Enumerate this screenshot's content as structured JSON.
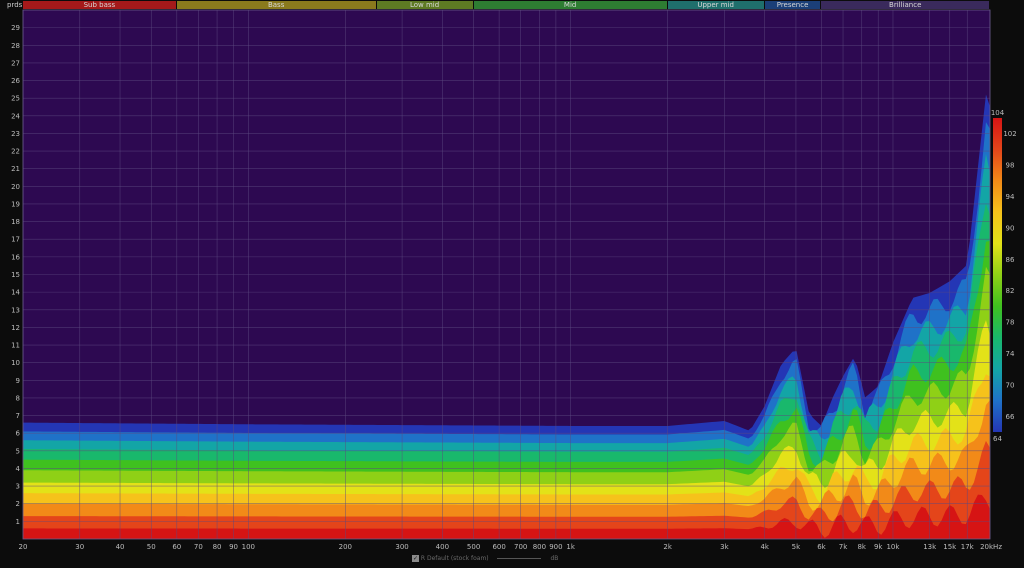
{
  "header": {
    "periods_label": "prds"
  },
  "bands": [
    {
      "name": "Sub bass",
      "from_hz": 20,
      "to_hz": 60,
      "color": "#a5191a"
    },
    {
      "name": "Bass",
      "from_hz": 60,
      "to_hz": 250,
      "color": "#8a7a1d"
    },
    {
      "name": "Low mid",
      "from_hz": 250,
      "to_hz": 500,
      "color": "#5e7a23"
    },
    {
      "name": "Mid",
      "from_hz": 500,
      "to_hz": 2000,
      "color": "#2e7d32"
    },
    {
      "name": "Upper mid",
      "from_hz": 2000,
      "to_hz": 4000,
      "color": "#1f6f6c"
    },
    {
      "name": "Presence",
      "from_hz": 4000,
      "to_hz": 6000,
      "color": "#1b3f78"
    },
    {
      "name": "Brilliance",
      "from_hz": 6000,
      "to_hz": 20000,
      "color": "#3a2a5c"
    }
  ],
  "legend": {
    "checked": true,
    "label": "R Default (stock foam)",
    "unit": "dB"
  },
  "chart_data": {
    "type": "heatmap",
    "title": "",
    "x_scale": "log",
    "xlim_hz": [
      20,
      20000
    ],
    "ylim_periods": [
      0,
      30
    ],
    "x_ticks": [
      {
        "v": 20,
        "label": "20"
      },
      {
        "v": 30,
        "label": "30"
      },
      {
        "v": 40,
        "label": "40"
      },
      {
        "v": 50,
        "label": "50"
      },
      {
        "v": 60,
        "label": "60"
      },
      {
        "v": 70,
        "label": "70"
      },
      {
        "v": 80,
        "label": "80"
      },
      {
        "v": 90,
        "label": "90"
      },
      {
        "v": 100,
        "label": "100"
      },
      {
        "v": 200,
        "label": "200"
      },
      {
        "v": 300,
        "label": "300"
      },
      {
        "v": 400,
        "label": "400"
      },
      {
        "v": 500,
        "label": "500"
      },
      {
        "v": 600,
        "label": "600"
      },
      {
        "v": 700,
        "label": "700"
      },
      {
        "v": 800,
        "label": "800"
      },
      {
        "v": 900,
        "label": "900"
      },
      {
        "v": 1000,
        "label": "1k"
      },
      {
        "v": 2000,
        "label": "2k"
      },
      {
        "v": 3000,
        "label": "3k"
      },
      {
        "v": 4000,
        "label": "4k"
      },
      {
        "v": 5000,
        "label": "5k"
      },
      {
        "v": 6000,
        "label": "6k"
      },
      {
        "v": 7000,
        "label": "7k"
      },
      {
        "v": 8000,
        "label": "8k"
      },
      {
        "v": 9000,
        "label": "9k"
      },
      {
        "v": 10000,
        "label": "10k"
      },
      {
        "v": 13000,
        "label": "13k"
      },
      {
        "v": 15000,
        "label": "15k"
      },
      {
        "v": 17000,
        "label": "17k"
      },
      {
        "v": 20000,
        "label": "20kHz"
      }
    ],
    "y_ticks": [
      1,
      2,
      3,
      4,
      5,
      6,
      7,
      8,
      9,
      10,
      11,
      12,
      13,
      14,
      15,
      16,
      17,
      18,
      19,
      20,
      21,
      22,
      23,
      24,
      25,
      26,
      27,
      28,
      29
    ],
    "colorbar": {
      "min": 64,
      "max": 104,
      "ticks": [
        64,
        66,
        70,
        74,
        78,
        82,
        86,
        90,
        94,
        98,
        102,
        104
      ]
    },
    "decay_envelope": [
      {
        "hz": 20,
        "periods": 7.0
      },
      {
        "hz": 100,
        "periods": 6.9
      },
      {
        "hz": 1000,
        "periods": 6.8
      },
      {
        "hz": 2000,
        "periods": 6.8
      },
      {
        "hz": 3000,
        "periods": 7.1
      },
      {
        "hz": 3600,
        "periods": 6.5
      },
      {
        "hz": 4000,
        "periods": 8.0
      },
      {
        "hz": 4500,
        "periods": 10.5
      },
      {
        "hz": 5000,
        "periods": 11.5
      },
      {
        "hz": 5500,
        "periods": 7.5
      },
      {
        "hz": 6000,
        "periods": 6.8
      },
      {
        "hz": 6500,
        "periods": 8.5
      },
      {
        "hz": 7000,
        "periods": 9.8
      },
      {
        "hz": 7600,
        "periods": 11.0
      },
      {
        "hz": 8200,
        "periods": 8.5
      },
      {
        "hz": 9000,
        "periods": 9.2
      },
      {
        "hz": 10000,
        "periods": 11.8
      },
      {
        "hz": 11500,
        "periods": 14.5
      },
      {
        "hz": 13000,
        "periods": 14.8
      },
      {
        "hz": 15000,
        "periods": 15.5
      },
      {
        "hz": 17000,
        "periods": 16.5
      },
      {
        "hz": 18500,
        "periods": 23.0
      },
      {
        "hz": 19500,
        "periods": 27.0
      },
      {
        "hz": 20000,
        "periods": 26.0
      }
    ],
    "color_layers": [
      {
        "level_db": 66,
        "color": "#2436b5",
        "periods_at_20hz": 6.6
      },
      {
        "level_db": 70,
        "color": "#1f72c8",
        "periods_at_20hz": 6.1
      },
      {
        "level_db": 74,
        "color": "#13a5a6",
        "periods_at_20hz": 5.6
      },
      {
        "level_db": 78,
        "color": "#19b86c",
        "periods_at_20hz": 5.1
      },
      {
        "level_db": 82,
        "color": "#3fc11f",
        "periods_at_20hz": 4.5
      },
      {
        "level_db": 86,
        "color": "#8fd016",
        "periods_at_20hz": 3.9
      },
      {
        "level_db": 90,
        "color": "#e3e218",
        "periods_at_20hz": 3.2
      },
      {
        "level_db": 94,
        "color": "#f6c21b",
        "periods_at_20hz": 2.6
      },
      {
        "level_db": 98,
        "color": "#f28a18",
        "periods_at_20hz": 2.0
      },
      {
        "level_db": 102,
        "color": "#e4451a",
        "periods_at_20hz": 1.3
      },
      {
        "level_db": 104,
        "color": "#d61414",
        "periods_at_20hz": 0.6
      }
    ]
  }
}
